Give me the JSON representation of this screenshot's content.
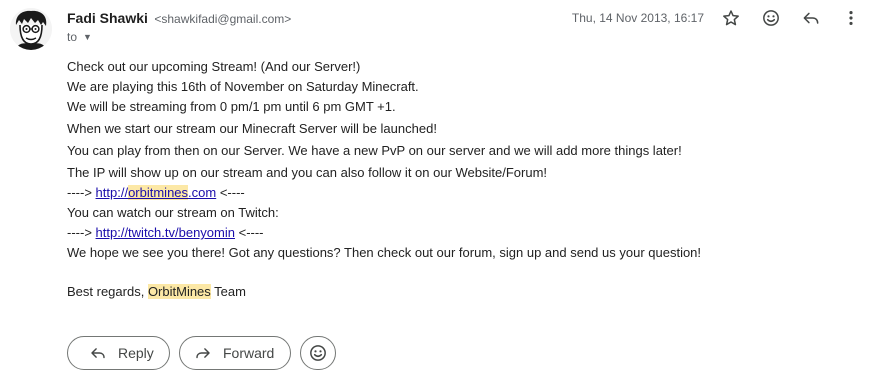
{
  "sender": {
    "name": "Fadi Shawki",
    "email": "<shawkifadi@gmail.com>"
  },
  "recipient": {
    "to_label": "to"
  },
  "date": "Thu, 14 Nov 2013, 16:17",
  "header_icons": [
    "star-icon",
    "emoji-icon",
    "reply-icon",
    "more-vert-icon"
  ],
  "body": {
    "line1": "Check out our upcoming Stream! (And our Server!)",
    "line2": "We are playing this 16th of November on Saturday Minecraft.",
    "line3": "We will be streaming from 0 pm/1 pm until 6 pm GMT +1.",
    "line4": "When we start our stream our Minecraft Server will be launched!",
    "line5": "You can play from then on our Server. We have a new PvP on our server and we will add more things later!",
    "line6": "The IP will show up on our stream and you can also follow it on our Website/Forum!",
    "line7": {
      "prefix": "----> ",
      "link_pre": "http://",
      "link_hl": "orbitmines",
      "link_post": ".com",
      "suffix": " <----"
    },
    "line8": "You can watch our stream on Twitch:",
    "line9": {
      "prefix": "----> ",
      "link": "http://twitch.tv/benyomin",
      "suffix": " <----"
    },
    "line10": "We hope we see you there! Got any questions? Then check out our forum, sign up and send us your question!",
    "signoff": {
      "pre": "Best regards, ",
      "hl": "OrbitMines",
      "post": " Team"
    }
  },
  "actions": {
    "reply_label": "Reply",
    "forward_label": "Forward"
  },
  "colors": {
    "highlight": "#fce8a6",
    "link": "#1a0dab",
    "meta_text": "#5f6368"
  }
}
